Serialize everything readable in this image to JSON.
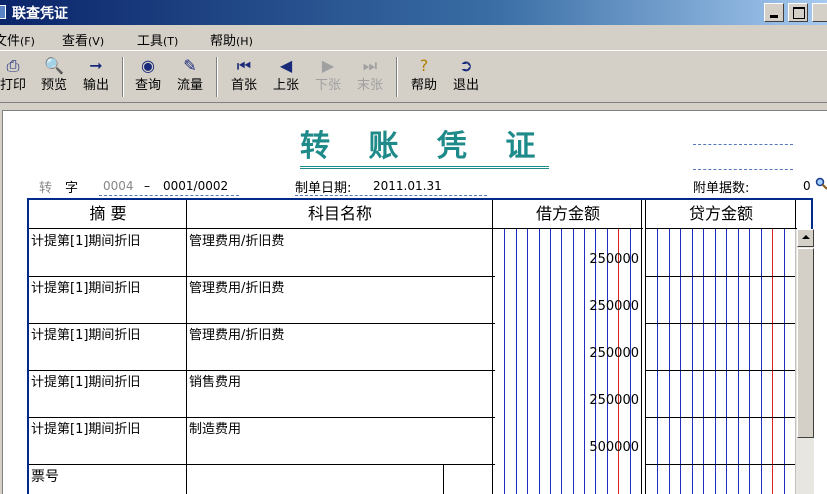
{
  "window": {
    "title": "联查凭证"
  },
  "menu": [
    {
      "label": "文件",
      "key": "(F)"
    },
    {
      "label": "查看",
      "key": "(V)"
    },
    {
      "label": "工具",
      "key": "(T)"
    },
    {
      "label": "帮助",
      "key": "(H)"
    }
  ],
  "toolbar": {
    "print": "打印",
    "preview": "预览",
    "export": "输出",
    "query": "查询",
    "flow": "流量",
    "first": "首张",
    "prev": "上张",
    "next": "下张",
    "last": "末张",
    "help": "帮助",
    "exit": "退出"
  },
  "voucher": {
    "title": "转 账 凭 证",
    "type_label": "转",
    "zi": "字",
    "number": "0004",
    "dash": "–",
    "sequence": "0001/0002",
    "date_label": "制单日期:",
    "date": "2011.01.31",
    "attach_label": "附单据数:",
    "attach_count": "0"
  },
  "table": {
    "headers": {
      "summary": "摘 要",
      "account": "科目名称",
      "debit": "借方金额",
      "credit": "贷方金额"
    },
    "rows": [
      {
        "summary": "计提第[1]期间折旧",
        "account": "管理费用/折旧费",
        "debit": "250000"
      },
      {
        "summary": "计提第[1]期间折旧",
        "account": "管理费用/折旧费",
        "debit": "250000"
      },
      {
        "summary": "计提第[1]期间折旧",
        "account": "管理费用/折旧费",
        "debit": "250000"
      },
      {
        "summary": "计提第[1]期间折旧",
        "account": "销售费用",
        "debit": "250000"
      },
      {
        "summary": "计提第[1]期间折旧",
        "account": "制造费用",
        "debit": "500000"
      }
    ],
    "footer_label": "票号"
  },
  "colors": {
    "title": "#1e8a8a",
    "grid_blue": "#2030c0",
    "grid_red": "#e02020",
    "border": "#002a8a"
  }
}
